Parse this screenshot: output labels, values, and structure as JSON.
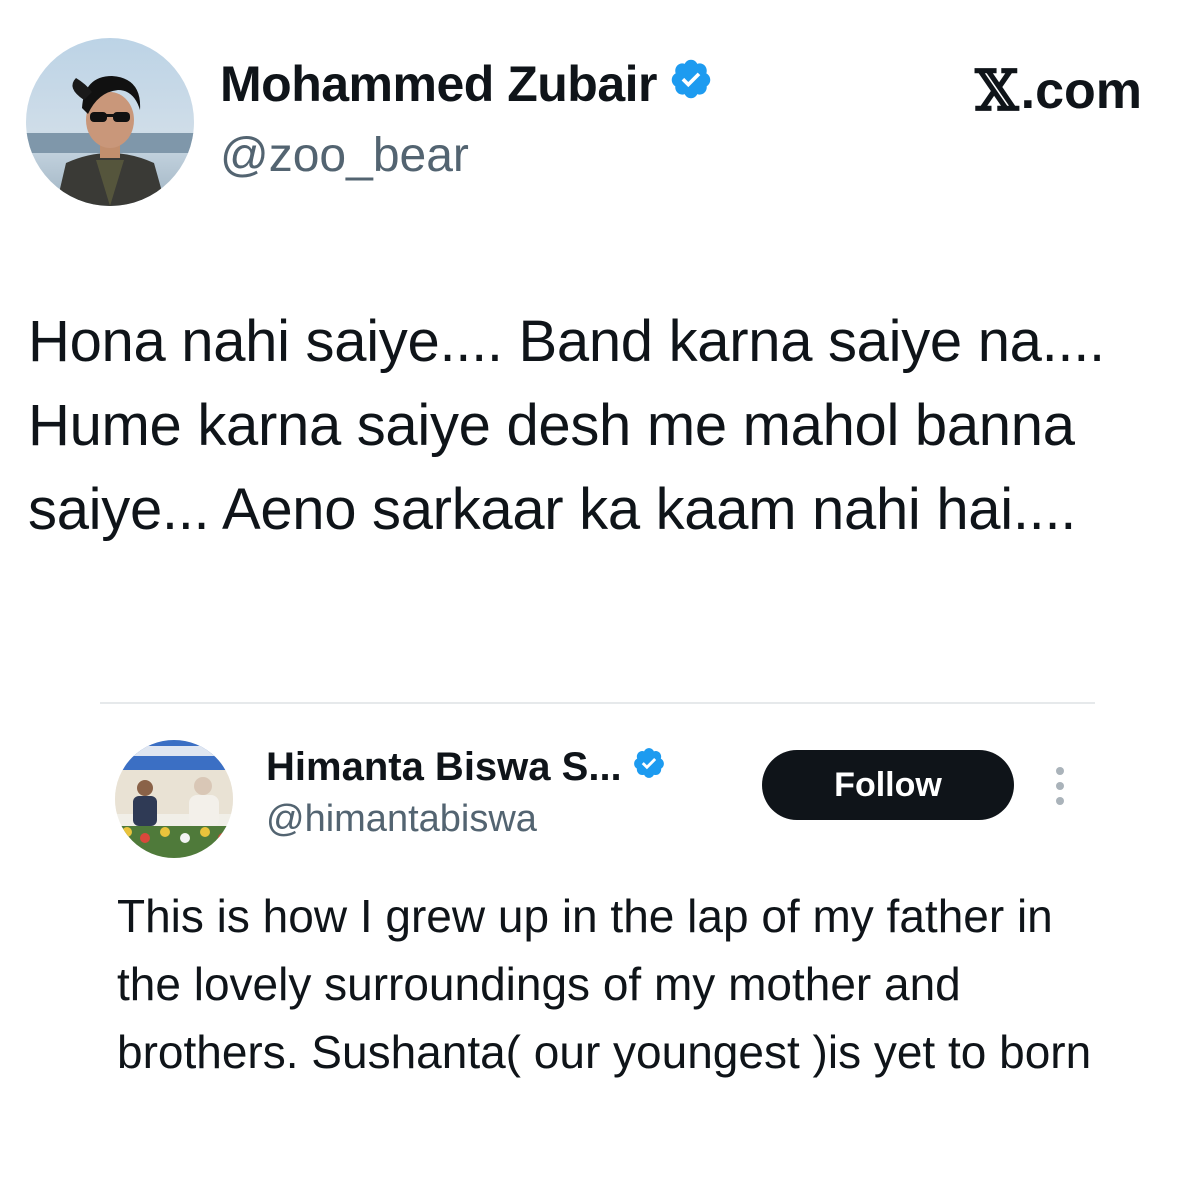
{
  "header": {
    "author_name": "Mohammed Zubair",
    "author_handle": "@zoo_bear",
    "brand_symbol": "𝕏",
    "brand_suffix": ".com",
    "verified_icon": "verified-badge-icon",
    "accent_color": "#1d9bf0"
  },
  "tweet": {
    "text": "Hona nahi saiye.... Band karna saiye na.... Hume karna saiye desh me mahol banna saiye... Aeno sarkaar ka kaam nahi hai...."
  },
  "quoted": {
    "author_name": "Himanta Biswa S...",
    "author_handle": "@himantabiswa",
    "follow_label": "Follow",
    "more_icon": "more-vertical-icon",
    "text": "This is how I grew up in the lap of my father in the lovely surroundings of my mother and brothers. Sushanta( our youngest )is yet to born"
  }
}
